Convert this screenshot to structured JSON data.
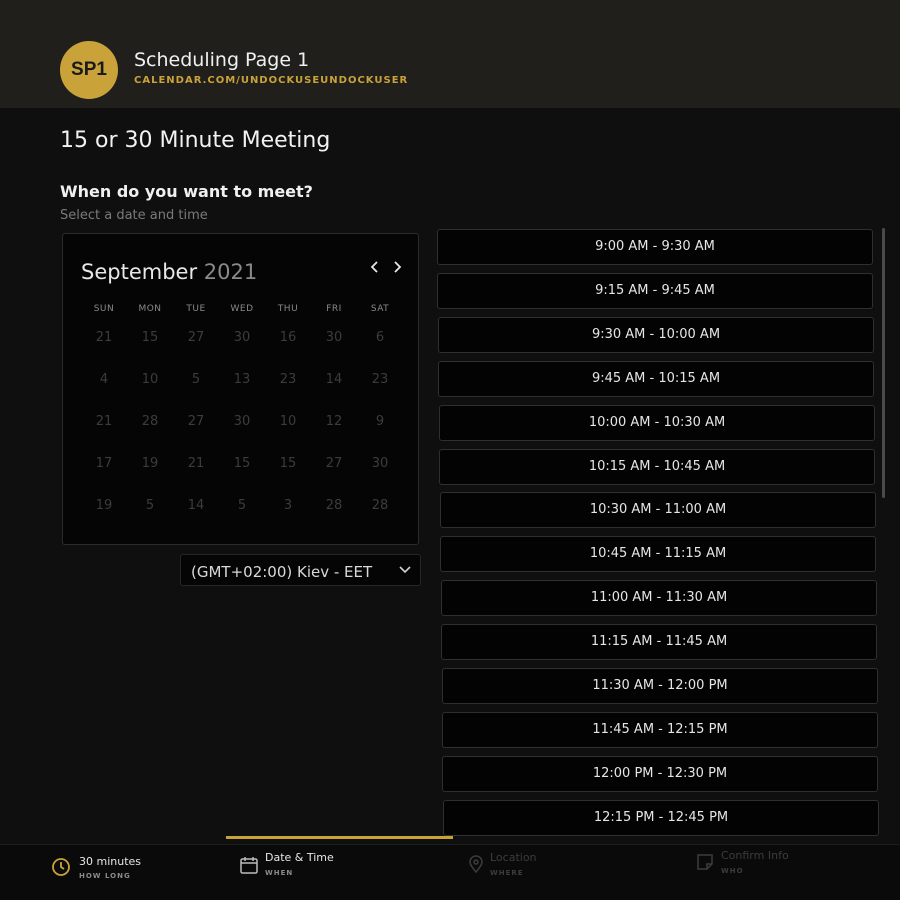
{
  "header": {
    "avatar_initials": "SP1",
    "title": "Scheduling Page 1",
    "url": "CALENDAR.COM/UNDOCKUSEUNDOCKUSER",
    "brand_color": "#c9a33a"
  },
  "page": {
    "title": "15 or 30 Minute Meeting",
    "section_title": "When do you want to meet?",
    "section_subtitle": "Select a date and time"
  },
  "calendar": {
    "month": "September",
    "year": "2021",
    "prev_icon": "chevron-left-icon",
    "next_icon": "chevron-right-icon",
    "weekdays": [
      "SUN",
      "MON",
      "TUE",
      "WED",
      "THU",
      "FRI",
      "SAT"
    ],
    "weeks": [
      [
        "21",
        "15",
        "27",
        "30",
        "16",
        "30",
        "6"
      ],
      [
        "4",
        "10",
        "5",
        "13",
        "23",
        "14",
        "23"
      ],
      [
        "21",
        "28",
        "27",
        "30",
        "10",
        "12",
        "9"
      ],
      [
        "17",
        "19",
        "21",
        "15",
        "15",
        "27",
        "30"
      ],
      [
        "19",
        "5",
        "14",
        "5",
        "3",
        "28",
        "28"
      ]
    ]
  },
  "timezone": {
    "value": "(GMT+02:00) Kiev - EET",
    "icon": "chevron-down-icon"
  },
  "slots": [
    "9:00 AM - 9:30 AM",
    "9:15 AM - 9:45 AM",
    "9:30 AM - 10:00 AM",
    "9:45 AM - 10:15 AM",
    "10:00 AM - 10:30 AM",
    "10:15 AM - 10:45 AM",
    "10:30 AM - 11:00 AM",
    "10:45 AM - 11:15 AM",
    "11:00 AM - 11:30 AM",
    "11:15 AM - 11:45 AM",
    "11:30 AM - 12:00 PM",
    "11:45 AM - 12:15 PM",
    "12:00 PM - 12:30 PM",
    "12:15 PM - 12:45 PM"
  ],
  "steps": [
    {
      "label": "30 minutes",
      "sub": "HOW LONG",
      "icon": "clock-icon",
      "state": "done"
    },
    {
      "label": "Date & Time",
      "sub": "WHEN",
      "icon": "calendar-icon",
      "state": "active"
    },
    {
      "label": "Location",
      "sub": "WHERE",
      "icon": "location-pin-icon",
      "state": "inactive"
    },
    {
      "label": "Confirm Info",
      "sub": "WHO",
      "icon": "note-icon",
      "state": "inactive"
    }
  ]
}
